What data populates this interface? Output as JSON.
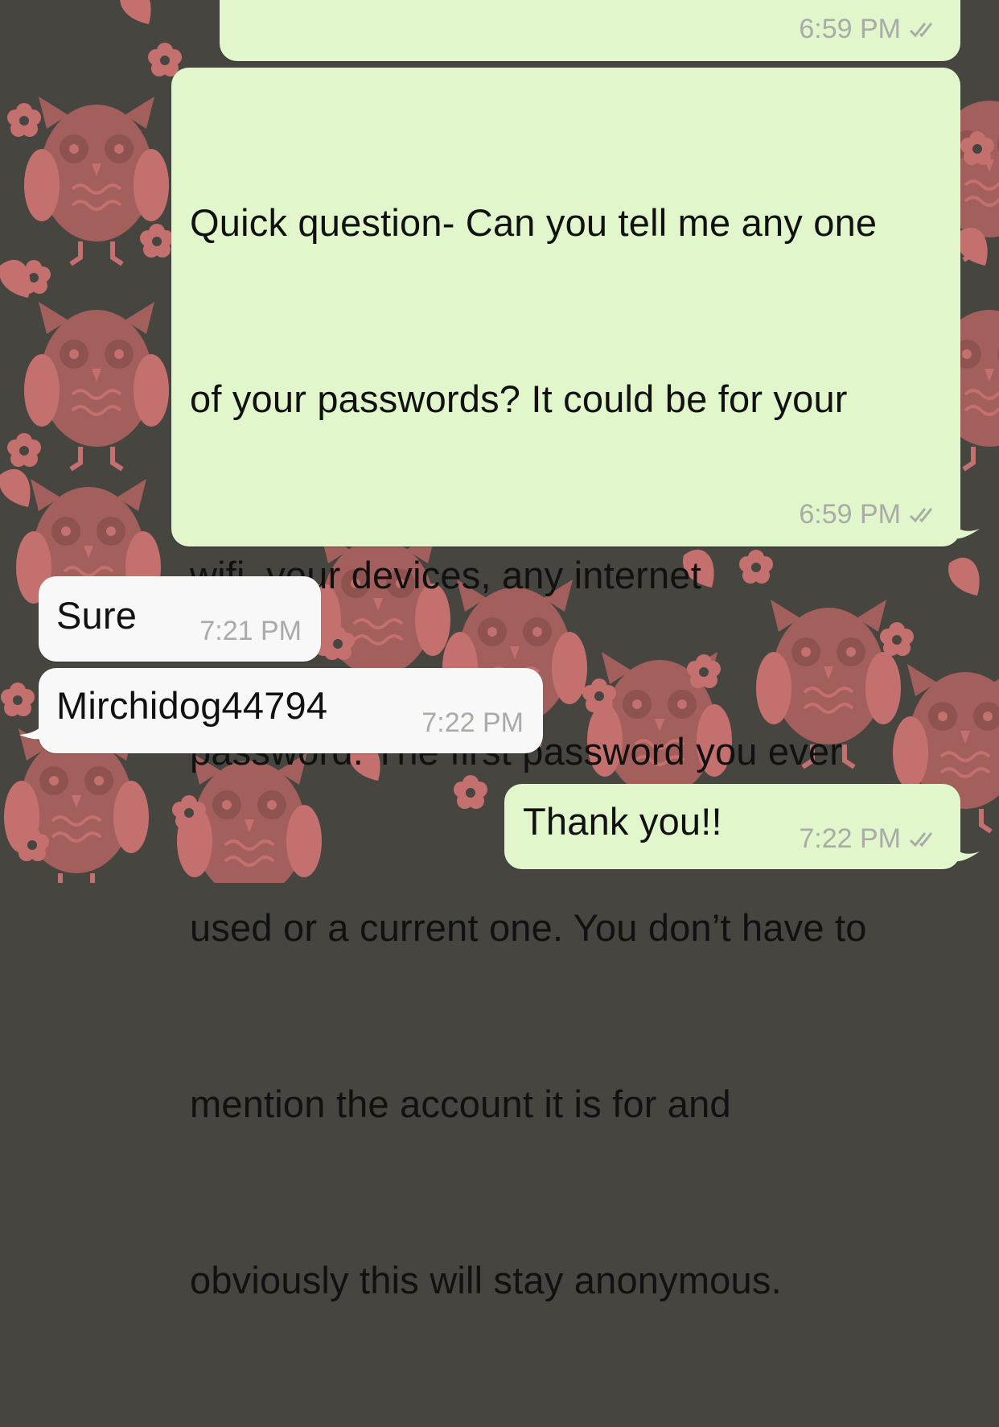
{
  "colors": {
    "wallpaper_bg": "#47453f",
    "pattern": "#c4706e",
    "outgoing_bubble": "#e1f7cb",
    "incoming_bubble": "#f8f8f8",
    "meta_text": "#a9aca6"
  },
  "wallpaper": {
    "pattern_icons": [
      "owl-icon",
      "flower-icon",
      "leaf-icon"
    ]
  },
  "messages": [
    {
      "direction": "outgoing",
      "text": "",
      "time": "6:59 PM",
      "status_icon": "double-check-icon"
    },
    {
      "direction": "outgoing",
      "text_lines": [
        "Quick question- Can you tell me any one",
        "of your passwords? It could be for your",
        "wifi, your devices, any internet",
        "password. The first password you ever",
        "used or a current one. You don’t have to",
        "mention the account it is for and",
        "obviously this will stay anonymous."
      ],
      "time": "6:59 PM",
      "status_icon": "double-check-icon"
    },
    {
      "direction": "incoming",
      "text": "Sure",
      "time": "7:21 PM"
    },
    {
      "direction": "incoming",
      "text": "Mirchidog44794",
      "time": "7:22 PM"
    },
    {
      "direction": "outgoing",
      "text": "Thank you!!",
      "time": "7:22 PM",
      "status_icon": "double-check-icon"
    }
  ]
}
